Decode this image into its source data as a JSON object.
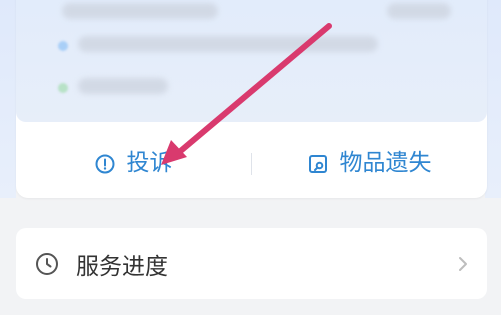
{
  "actions": {
    "complaint_label": "投诉",
    "lost_item_label": "物品遗失"
  },
  "progress": {
    "label": "服务进度"
  },
  "colors": {
    "accent": "#2f86d1",
    "annotation_arrow": "#d93a6e",
    "background": "#f2f3f5",
    "card": "#ffffff"
  },
  "icons": {
    "complaint": "alert-circle-icon",
    "lost_item": "search-document-icon",
    "progress": "clock-icon",
    "chevron": "chevron-right-icon"
  }
}
